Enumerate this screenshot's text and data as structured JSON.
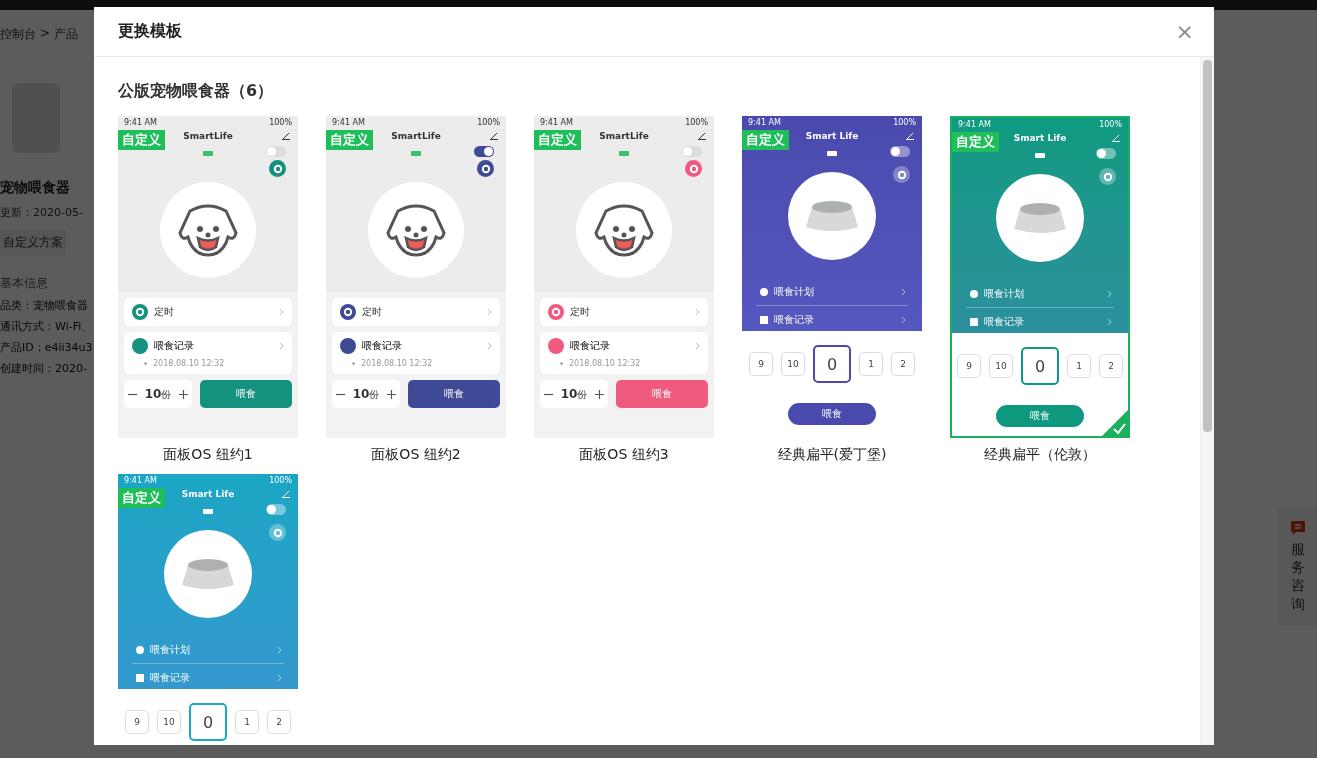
{
  "background_page": {
    "breadcrumb": [
      "控制台",
      ">",
      "产品"
    ],
    "product": {
      "name": "宠物喂食器",
      "updated": "更新：2020-05-",
      "tag": "自定义方案",
      "section": "基本信息",
      "fields": [
        "品类：宠物喂食器",
        "通讯方式：Wi-Fi、",
        "产品ID：e4ii34u3",
        "创建时间：2020-"
      ]
    },
    "service": {
      "label": "服务咨询"
    }
  },
  "dialog": {
    "title": "更换模板",
    "close": "×",
    "section_title": "公版宠物喂食器（6）",
    "templates": [
      {
        "kind": "panel_os",
        "name": "面板OS 纽约1",
        "selected": false,
        "badge": "自定义",
        "color": "#14917f",
        "preview": {
          "time": "9:41 AM",
          "battery": "100%",
          "title": "SmartLife",
          "toggle_on": false,
          "rows": [
            "定时",
            "喂食记录"
          ],
          "record": "2018.08.10 12:32",
          "amount": "10",
          "unit": "份",
          "feed": "喂食"
        }
      },
      {
        "kind": "panel_os",
        "name": "面板OS 纽约2",
        "selected": false,
        "badge": "自定义",
        "color": "#3f4a96",
        "preview": {
          "time": "9:41 AM",
          "battery": "100%",
          "title": "SmartLife",
          "toggle_on": true,
          "rows": [
            "定时",
            "喂食记录"
          ],
          "record": "2018.08.10 12:32",
          "amount": "10",
          "unit": "份",
          "feed": "喂食"
        }
      },
      {
        "kind": "panel_os",
        "name": "面板OS 纽约3",
        "selected": false,
        "badge": "自定义",
        "color": "#ef5a7e",
        "preview": {
          "time": "9:41 AM",
          "battery": "100%",
          "title": "SmartLife",
          "toggle_on": false,
          "rows": [
            "定时",
            "喂食记录"
          ],
          "record": "2018.08.10 12:32",
          "amount": "10",
          "unit": "份",
          "feed": "喂食"
        }
      },
      {
        "kind": "classic",
        "name": "经典扁平(爱丁堡)",
        "selected": false,
        "badge": "自定义",
        "color": "#4a4aae",
        "preview": {
          "time": "9:41 AM",
          "battery": "100%",
          "title": "Smart Life",
          "toggle_on": false,
          "rows": [
            "喂食计划",
            "喂食记录"
          ],
          "picker": [
            "9",
            "10",
            "0",
            "1",
            "2"
          ],
          "feed": "喂食"
        }
      },
      {
        "kind": "classic",
        "name": "经典扁平（伦敦）",
        "selected": true,
        "badge": "自定义",
        "color": "#0f9a80",
        "preview": {
          "time": "9:41 AM",
          "battery": "100%",
          "title": "Smart Life",
          "toggle_on": false,
          "rows": [
            "喂食计划",
            "喂食记录"
          ],
          "picker": [
            "9",
            "10",
            "0",
            "1",
            "2"
          ],
          "feed": "喂食"
        }
      },
      {
        "kind": "classic",
        "selected": false,
        "badge": "自定义",
        "color": "#1aa6c4",
        "preview": {
          "time": "9:41 AM",
          "battery": "100%",
          "title": "Smart Life",
          "toggle_on": false,
          "rows": [
            "喂食计划",
            "喂食记录"
          ],
          "picker": [
            "9",
            "10",
            "0",
            "1",
            "2"
          ]
        }
      }
    ]
  }
}
